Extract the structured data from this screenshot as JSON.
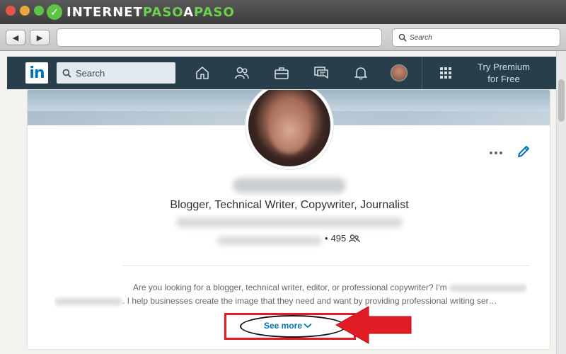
{
  "browser": {
    "brand": {
      "part1": "INTERNET",
      "part2": "PASO",
      "part3": "A",
      "part4": "PASO"
    },
    "back_icon": "◀",
    "forward_icon": "▶",
    "search_placeholder": "Search"
  },
  "linkedin": {
    "logo": "in",
    "search_placeholder": "Search",
    "nav_icons": [
      "home-icon",
      "my-network-icon",
      "jobs-icon",
      "messaging-icon",
      "notifications-icon"
    ],
    "premium_line1": "Try Premium",
    "premium_line2": "for Free"
  },
  "profile": {
    "headline": "Blogger, Technical Writer, Copywriter, Journalist",
    "connections": "495",
    "summary_start": "Are you looking for a blogger, technical writer, editor, or professional copywriter? I'm",
    "summary_mid": ". I help businesses create the image that they need and want by providing professional writing ser…",
    "see_more": "See more"
  },
  "colors": {
    "linkedin_header": "#283e4a",
    "linkedin_blue": "#0073b1",
    "highlight_red": "#e01c24"
  }
}
